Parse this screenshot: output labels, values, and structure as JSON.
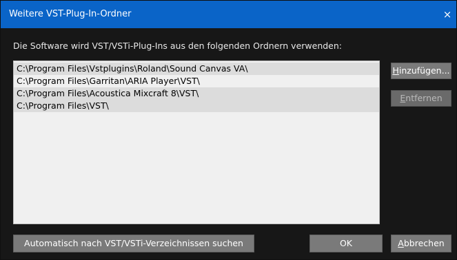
{
  "window": {
    "title": "Weitere VST-Plug-In-Ordner",
    "close_glyph": "×"
  },
  "description": "Die Software wird VST/VSTi-Plug-Ins aus den folgenden Ordnern verwenden:",
  "folders": [
    "C:\\Program Files\\Vstplugins\\Roland\\Sound Canvas VA\\",
    "C:\\Program Files\\Garritan\\ARIA Player\\VST\\",
    "C:\\Program Files\\Acoustica Mixcraft 8\\VST\\",
    "C:\\Program Files\\VST\\"
  ],
  "buttons": {
    "add": {
      "first": "H",
      "rest": "inzufügen..."
    },
    "remove": {
      "first": "E",
      "rest": "ntfernen"
    },
    "auto_search": "Automatisch nach VST/VSTi-Verzeichnissen suchen",
    "ok": "OK",
    "cancel": {
      "first": "A",
      "rest": "bbrechen"
    }
  },
  "icons": {
    "close": "close-icon"
  },
  "colors": {
    "titlebar": "#0a64c8",
    "background": "#171717",
    "list_background": "#f0f0f0",
    "list_row_alt": "#dcdcdc",
    "button": "#7a7a7a"
  }
}
